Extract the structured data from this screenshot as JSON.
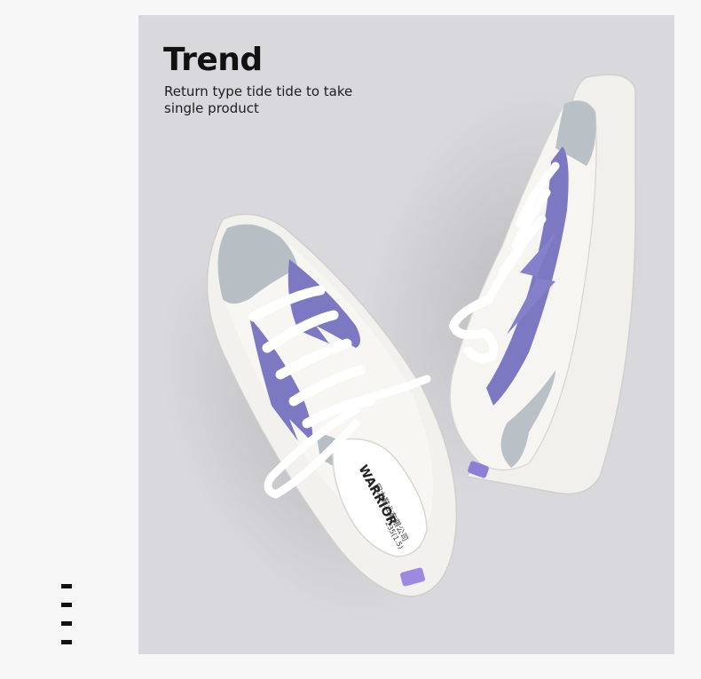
{
  "header": {
    "title": "Trend",
    "subtitle": "Return type tide tide to take single product"
  },
  "photo": {
    "insole_brand_text": "WARRIOR",
    "insole_maker_text": "回力鞋业有限公司",
    "insole_size_text": "235(1.5)"
  },
  "colors": {
    "panel_background": "#d9d9dd",
    "page_background": "#f7f7f7",
    "accent_purple": "#7d78c2",
    "suede_grey": "#b9c1c6",
    "canvas_white": "#f5f4f1"
  },
  "page_indicator": {
    "marks": 4
  }
}
